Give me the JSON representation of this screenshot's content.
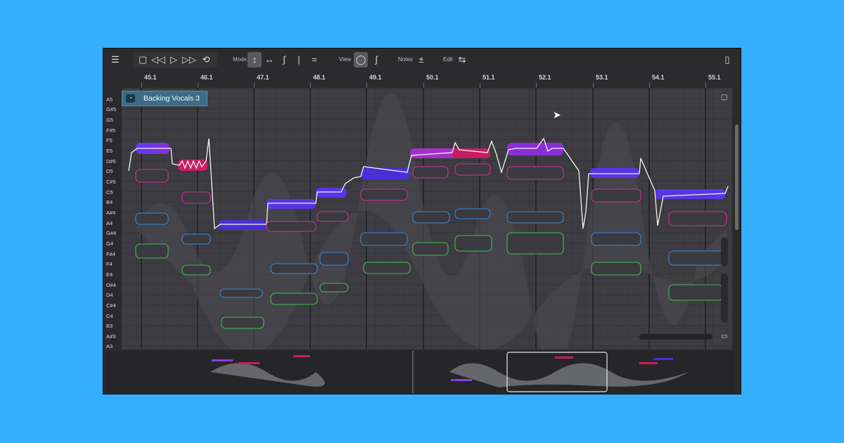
{
  "toolbar": {
    "menu_icon": "☰",
    "transport": [
      "▢",
      "◁◁",
      "▷",
      "▷▷",
      "⟲"
    ],
    "mode_label": "Mode",
    "mode_tools": [
      "↕",
      "↔",
      "∫",
      "|◯|",
      "="
    ],
    "view_label": "View",
    "view_tools": [
      "◯",
      "∫"
    ],
    "notes_label": "Notes",
    "notes_icon": "±",
    "edit_label": "Edit",
    "edit_icon": "⇆",
    "panel_icon": "▯"
  },
  "ruler": [
    "45.1",
    "46.1",
    "47.1",
    "48.1",
    "49.1",
    "50.1",
    "51.1",
    "52.1",
    "53.1",
    "54.1",
    "55.1"
  ],
  "keys": [
    "A5",
    "G#5",
    "G5",
    "F#5",
    "F5",
    "E5",
    "D#5",
    "D5",
    "C#5",
    "C5",
    "B4",
    "A#4",
    "A4",
    "G#4",
    "G4",
    "F#4",
    "F4",
    "E4",
    "D#4",
    "D4",
    "C#4",
    "C4",
    "B3",
    "A#3",
    "A3"
  ],
  "track": {
    "name": "Backing Vocals 3"
  },
  "colors": {
    "lead": "#4a2fd6",
    "lead_hot": "#c81d64",
    "harmony_magenta": "#d0309a",
    "harmony_blue": "#3e86d6",
    "harmony_green": "#3fbf4a",
    "background": "#35aeff"
  }
}
